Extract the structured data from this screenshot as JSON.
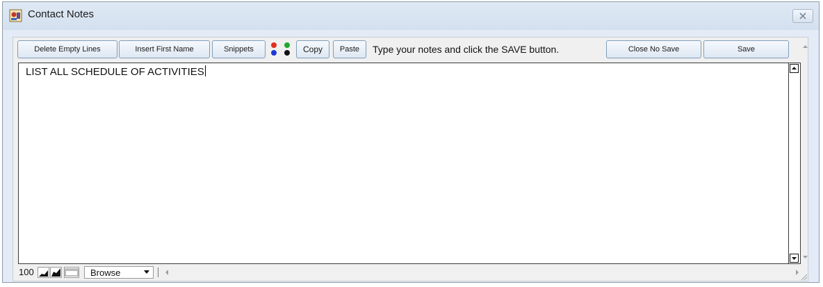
{
  "window": {
    "title": "Contact Notes",
    "close_label": "✕"
  },
  "toolbar": {
    "delete_empty_lines": "Delete Empty Lines",
    "insert_first_name": "Insert First Name",
    "snippets": "Snippets",
    "copy": "Copy",
    "paste": "Paste",
    "hint": "Type your notes and click the SAVE button.",
    "close_no_save": "Close No Save",
    "save": "Save",
    "color_dots": [
      "#e0301e",
      "#1ea82c",
      "#1d38d6",
      "#111111"
    ]
  },
  "editor": {
    "text": "LIST ALL SCHEDULE OF ACTIVITIES"
  },
  "statusbar": {
    "zoom": "100",
    "mode_selected": "Browse",
    "icons": [
      "graph-small-icon",
      "graph-large-icon",
      "layout-icon"
    ]
  }
}
